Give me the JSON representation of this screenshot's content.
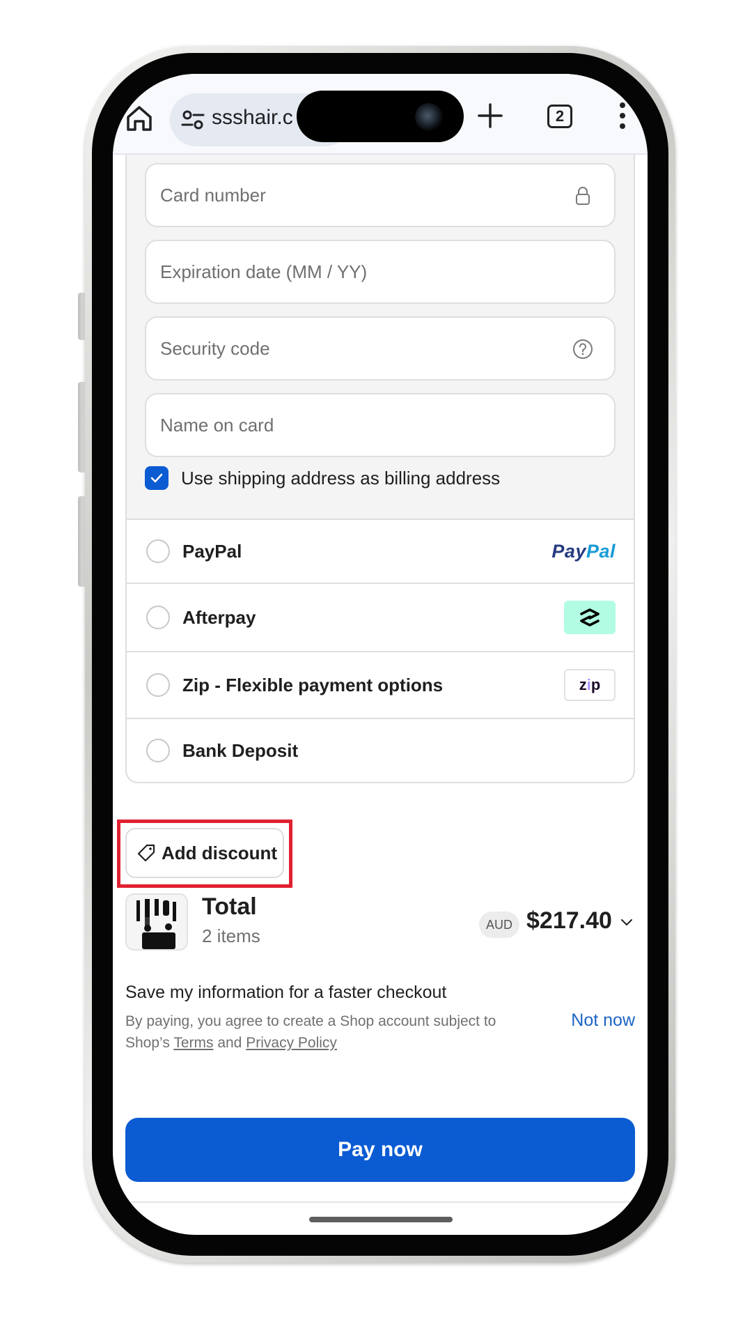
{
  "browser": {
    "url_text": "ssshair.c",
    "tab_count": "2"
  },
  "card_form": {
    "card_number_placeholder": "Card number",
    "expiry_placeholder": "Expiration date (MM / YY)",
    "security_code_placeholder": "Security code",
    "name_placeholder": "Name on card",
    "billing_checkbox_label": "Use shipping address as billing address",
    "billing_checkbox_checked": true
  },
  "payment_methods": [
    {
      "label": "PayPal",
      "logo": "paypal-logo"
    },
    {
      "label": "Afterpay",
      "logo": "afterpay-logo"
    },
    {
      "label": "Zip - Flexible payment options",
      "logo": "zip-logo"
    },
    {
      "label": "Bank Deposit",
      "logo": ""
    }
  ],
  "logos": {
    "paypal_part1": "Pay",
    "paypal_part2": "Pal",
    "zip_text_z": "z",
    "zip_text_i": "i",
    "zip_text_p": "p"
  },
  "discount": {
    "label": "Add discount",
    "highlight_color": "#e02030"
  },
  "total": {
    "title": "Total",
    "items": "2 items",
    "currency": "AUD",
    "amount": "$217.40"
  },
  "save_info": {
    "title": "Save my information for a faster checkout",
    "desc_prefix": "By paying, you agree to create a Shop account subject to Shop’s",
    "terms_link": "Terms",
    "and_text": "and",
    "privacy_link": "Privacy Policy",
    "not_now": "Not now"
  },
  "actions": {
    "pay_now": "Pay now"
  },
  "colors": {
    "accent": "#0b5bd3",
    "link": "#1b63c4"
  }
}
